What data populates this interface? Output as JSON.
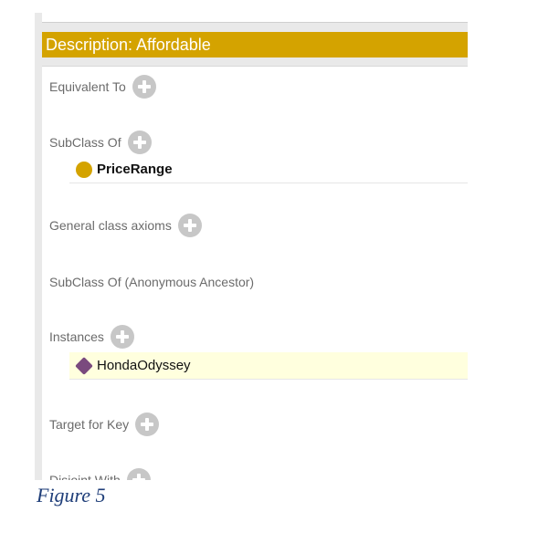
{
  "header": {
    "title": "Description: Affordable"
  },
  "sections": {
    "equivalent_to": {
      "label": "Equivalent To"
    },
    "subclass_of": {
      "label": "SubClass Of",
      "items": [
        "PriceRange"
      ]
    },
    "general_axioms": {
      "label": "General class axioms"
    },
    "anonymous_ancestor": {
      "label": "SubClass Of (Anonymous Ancestor)"
    },
    "instances": {
      "label": "Instances",
      "items": [
        "HondaOdyssey"
      ]
    },
    "target_for_key": {
      "label": "Target for Key"
    },
    "disjoint_with": {
      "label": "Disjoint With"
    }
  },
  "caption": "Figure 5",
  "colors": {
    "header_bg": "#d4a300",
    "class_icon": "#d4a300",
    "individual_icon": "#7a4a7e",
    "selection_bg": "#ffffde",
    "caption": "#1f3e79"
  },
  "icons": {
    "add": "add-icon",
    "class": "class-icon",
    "individual": "individual-icon"
  }
}
